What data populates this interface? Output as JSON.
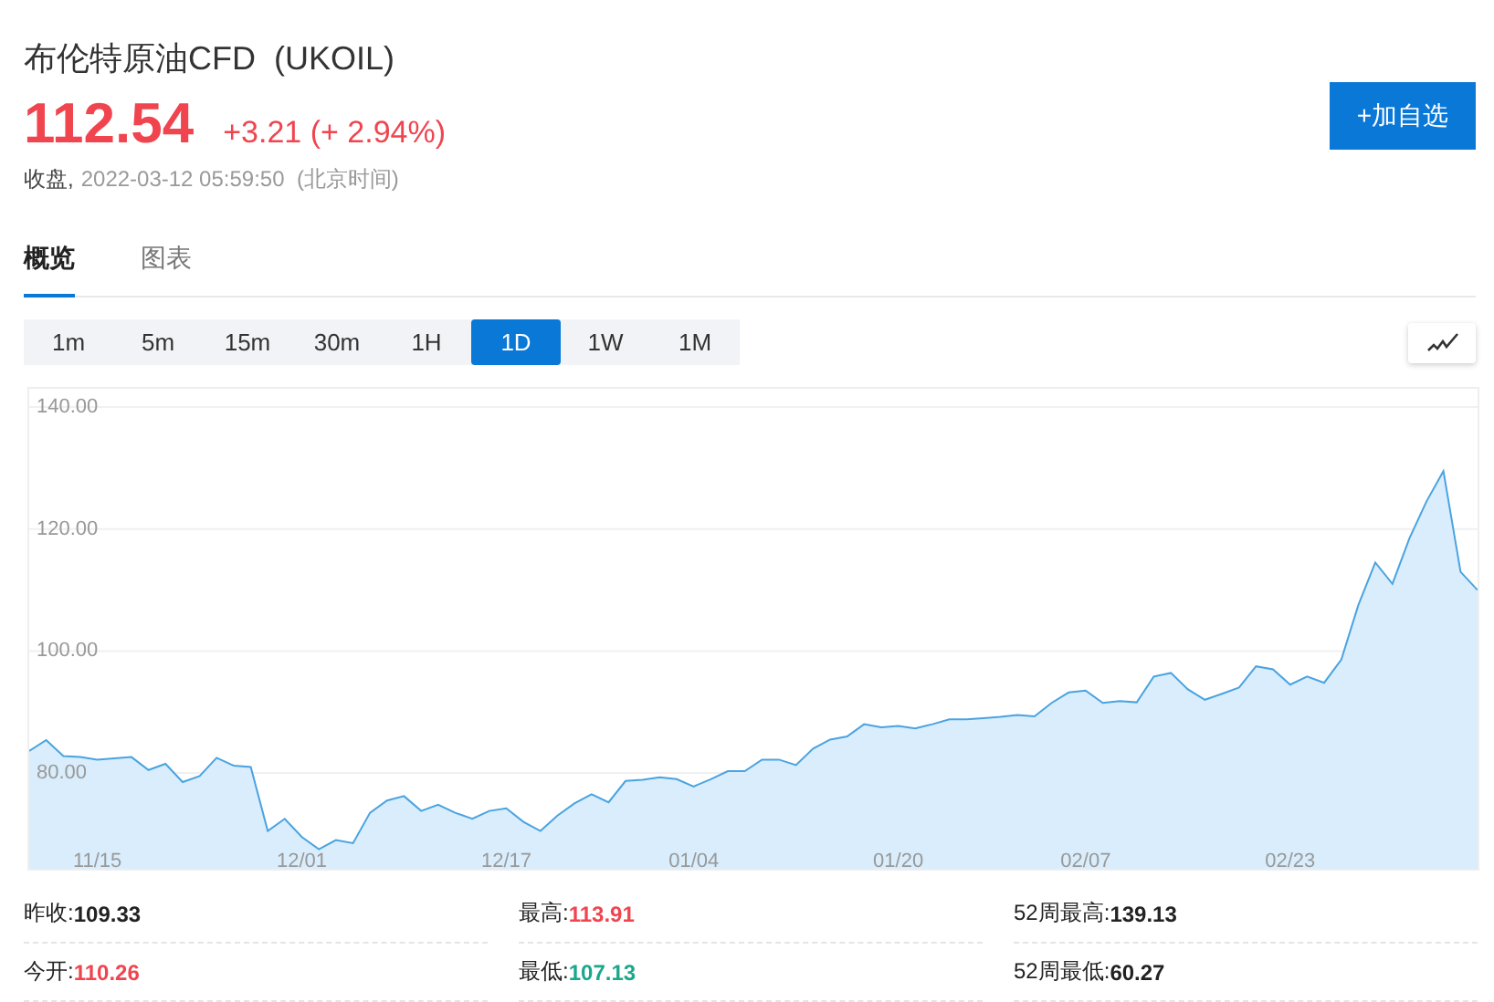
{
  "header": {
    "title": "布伦特原油CFD  (UKOIL)",
    "price": "112.54",
    "change": "+3.21 (+ 2.94%)",
    "color": "#f0454f",
    "status_label": "收盘,",
    "timestamp": "2022-03-12 05:59:50  (北京时间)",
    "add_button": "+加自选"
  },
  "tabs": [
    {
      "label": "概览",
      "selected": true
    },
    {
      "label": "图表",
      "selected": false
    }
  ],
  "periods": [
    {
      "label": "1m",
      "selected": false
    },
    {
      "label": "5m",
      "selected": false
    },
    {
      "label": "15m",
      "selected": false
    },
    {
      "label": "30m",
      "selected": false
    },
    {
      "label": "1H",
      "selected": false
    },
    {
      "label": "1D",
      "selected": true
    },
    {
      "label": "1W",
      "selected": false
    },
    {
      "label": "1M",
      "selected": false
    }
  ],
  "chart_data": {
    "type": "area",
    "grid": true,
    "ylim": [
      64,
      143
    ],
    "yticks": [
      {
        "value": 80,
        "label": "80.00"
      },
      {
        "value": 100,
        "label": "100.00"
      },
      {
        "value": 120,
        "label": "120.00"
      },
      {
        "value": 140,
        "label": "140.00"
      }
    ],
    "categories": [
      null,
      null,
      null,
      null,
      "11/15",
      null,
      null,
      null,
      null,
      null,
      null,
      null,
      null,
      null,
      null,
      null,
      "12/01",
      null,
      null,
      null,
      null,
      null,
      null,
      null,
      null,
      null,
      null,
      null,
      "12/17",
      null,
      null,
      null,
      null,
      null,
      null,
      null,
      null,
      null,
      null,
      "01/04",
      null,
      null,
      null,
      null,
      null,
      null,
      null,
      null,
      null,
      null,
      null,
      "01/20",
      null,
      null,
      null,
      null,
      null,
      null,
      null,
      null,
      null,
      null,
      "02/07",
      null,
      null,
      null,
      null,
      null,
      null,
      null,
      null,
      null,
      null,
      null,
      "02/23",
      null,
      null,
      null,
      null,
      null,
      null,
      null,
      null,
      null,
      null,
      null
    ],
    "series": [
      {
        "color": "#4aa3e0",
        "values": [
          83.6,
          85.4,
          82.8,
          82.6,
          82.2,
          82.4,
          82.6,
          80.5,
          81.5,
          78.5,
          79.5,
          82.5,
          81.2,
          81,
          70.5,
          72.5,
          69.5,
          67.5,
          69,
          68.5,
          73.5,
          75.5,
          76.2,
          73.8,
          74.8,
          73.5,
          72.5,
          73.8,
          74.2,
          72,
          70.5,
          73,
          75,
          76.5,
          75.2,
          78.7,
          78.9,
          79.3,
          79,
          77.8,
          79,
          80.3,
          80.3,
          82.2,
          82.2,
          81.3,
          84,
          85.5,
          86,
          88,
          87.5,
          87.7,
          87.3,
          88,
          88.8,
          88.8,
          89,
          89.2,
          89.5,
          89.3,
          91.5,
          93.2,
          93.5,
          91.5,
          91.8,
          91.6,
          95.8,
          96.4,
          93.7,
          92,
          93,
          94,
          97.5,
          97,
          94.5,
          95.8,
          94.8,
          98.6,
          107.5,
          114.5,
          111,
          118.5,
          124.5,
          129.5,
          113,
          110
        ]
      }
    ]
  },
  "stats": [
    {
      "label": "昨收:",
      "value": "109.33",
      "color": "#222222"
    },
    {
      "label": "最高:",
      "value": "113.91",
      "color": "#f0454f"
    },
    {
      "label": "52周最高:",
      "value": "139.13",
      "color": "#222222"
    },
    {
      "label": "今开:",
      "value": "110.26",
      "color": "#f0454f"
    },
    {
      "label": "最低:",
      "value": "107.13",
      "color": "#1aa88c"
    },
    {
      "label": "52周最低:",
      "value": "60.27",
      "color": "#222222"
    }
  ]
}
